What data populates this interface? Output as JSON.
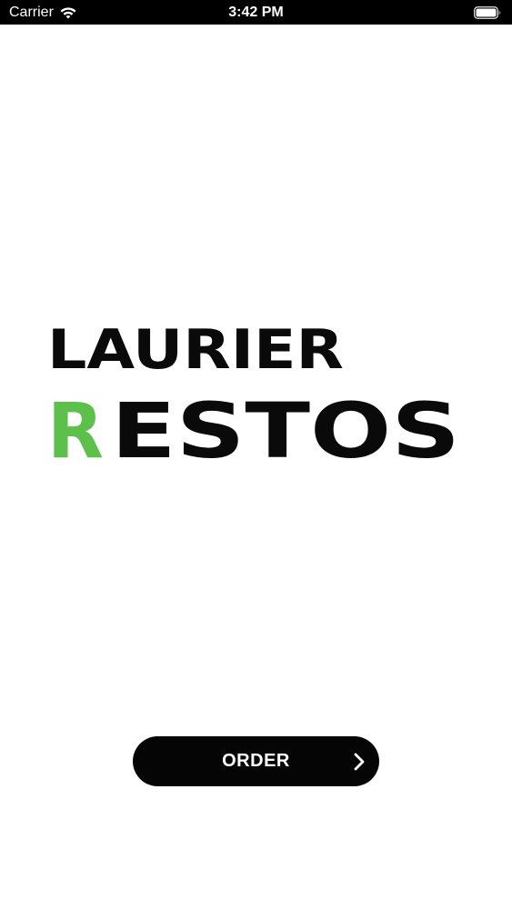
{
  "status_bar": {
    "carrier": "Carrier",
    "time": "3:42 PM",
    "wifi_icon": "wifi-icon",
    "battery_icon": "battery-icon"
  },
  "logo": {
    "line1": "LAURIER",
    "line2_first": "R",
    "line2_rest": "ESTOS",
    "accent_color": "#5cc04a",
    "text_color": "#0a0a0a"
  },
  "order_button": {
    "label": "ORDER",
    "icon": "chevron-right-icon",
    "background": "#050505"
  }
}
